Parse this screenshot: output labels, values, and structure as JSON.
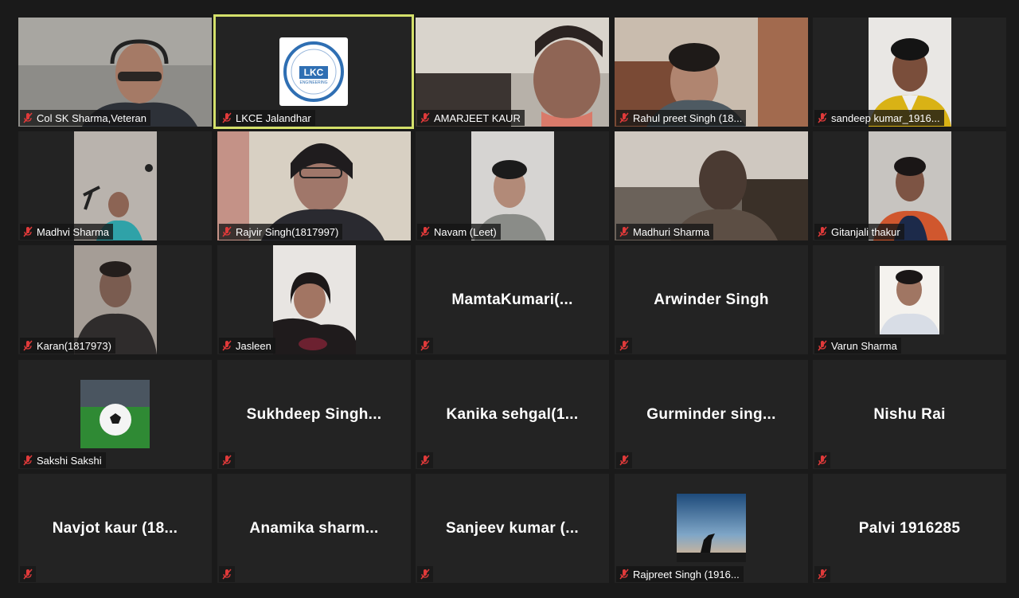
{
  "meeting": {
    "colors": {
      "background": "#1a1a1a",
      "tile": "#232323",
      "active_speaker_border": "#d4e06a",
      "muted_icon": "#e03a3a"
    }
  },
  "participants": [
    {
      "label": "Col SK Sharma,Veteran",
      "display_name": "",
      "video": "camera",
      "muted": true
    },
    {
      "label": "LKCE Jalandhar",
      "display_name": "",
      "video": "logo",
      "logo_text": "LKC",
      "logo_subtext": "ENGINEERING",
      "muted": true,
      "active_speaker": true
    },
    {
      "label": "AMARJEET KAUR",
      "display_name": "",
      "video": "camera",
      "muted": true
    },
    {
      "label": "Rahul preet Singh (18...",
      "display_name": "",
      "video": "camera",
      "muted": true
    },
    {
      "label": "sandeep kumar_1916...",
      "display_name": "",
      "video": "camera",
      "muted": true
    },
    {
      "label": "Madhvi Sharma",
      "display_name": "",
      "video": "camera",
      "muted": true
    },
    {
      "label": "Rajvir Singh(1817997)",
      "display_name": "",
      "video": "camera",
      "muted": true
    },
    {
      "label": "Navam (Leet)",
      "display_name": "",
      "video": "camera",
      "muted": true
    },
    {
      "label": "Madhuri Sharma",
      "display_name": "",
      "video": "camera",
      "muted": true
    },
    {
      "label": "Gitanjali thakur",
      "display_name": "",
      "video": "camera",
      "muted": true
    },
    {
      "label": "Karan(1817973)",
      "display_name": "",
      "video": "camera",
      "muted": true
    },
    {
      "label": "Jasleen",
      "display_name": "",
      "video": "camera",
      "muted": true
    },
    {
      "label": "",
      "display_name": "MamtaKumari(...",
      "video": "none",
      "muted": true
    },
    {
      "label": "",
      "display_name": "Arwinder Singh",
      "video": "none",
      "muted": true
    },
    {
      "label": "Varun Sharma",
      "display_name": "",
      "video": "profile-photo",
      "muted": true
    },
    {
      "label": "Sakshi Sakshi",
      "display_name": "",
      "video": "profile-photo-football",
      "muted": true
    },
    {
      "label": "",
      "display_name": "Sukhdeep  Singh...",
      "video": "none",
      "muted": true
    },
    {
      "label": "",
      "display_name": "Kanika  sehgal(1...",
      "video": "none",
      "muted": true
    },
    {
      "label": "",
      "display_name": "Gurminder  sing...",
      "video": "none",
      "muted": true
    },
    {
      "label": "",
      "display_name": "Nishu Rai",
      "video": "none",
      "muted": true
    },
    {
      "label": "",
      "display_name": "Navjot  kaur  (18...",
      "video": "none",
      "muted": true
    },
    {
      "label": "",
      "display_name": "Anamika  sharm...",
      "video": "none",
      "muted": true
    },
    {
      "label": "",
      "display_name": "Sanjeev  kumar  (...",
      "video": "none",
      "muted": true
    },
    {
      "label": "Rajpreet Singh (1916...",
      "display_name": "",
      "video": "profile-photo-silhouette",
      "muted": true
    },
    {
      "label": "",
      "display_name": "Palvi 1916285",
      "video": "none",
      "muted": true
    }
  ]
}
